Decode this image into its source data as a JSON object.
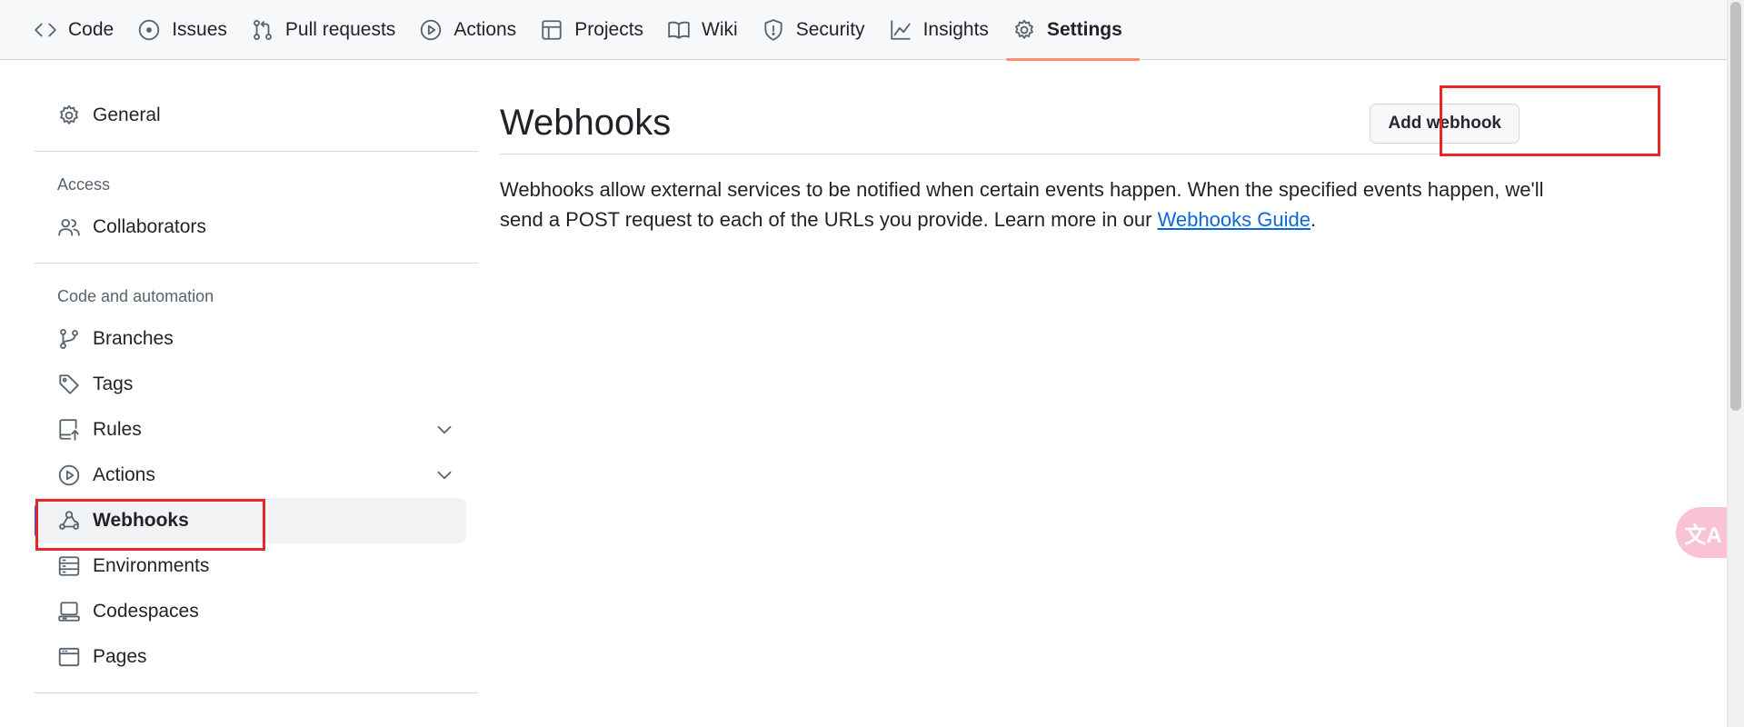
{
  "repo_nav": {
    "tabs": [
      {
        "label": "Code",
        "icon": "code-icon"
      },
      {
        "label": "Issues",
        "icon": "issue-opened-icon"
      },
      {
        "label": "Pull requests",
        "icon": "git-pull-request-icon"
      },
      {
        "label": "Actions",
        "icon": "play-icon"
      },
      {
        "label": "Projects",
        "icon": "table-icon"
      },
      {
        "label": "Wiki",
        "icon": "book-icon"
      },
      {
        "label": "Security",
        "icon": "shield-icon"
      },
      {
        "label": "Insights",
        "icon": "graph-icon"
      },
      {
        "label": "Settings",
        "icon": "gear-icon"
      }
    ],
    "active_tab": "Settings"
  },
  "sidebar": {
    "general": "General",
    "access_heading": "Access",
    "collaborators": "Collaborators",
    "code_heading": "Code and automation",
    "items": [
      {
        "label": "Branches",
        "icon": "git-branch-icon"
      },
      {
        "label": "Tags",
        "icon": "tag-icon"
      },
      {
        "label": "Rules",
        "icon": "repo-push-icon",
        "expandable": true
      },
      {
        "label": "Actions",
        "icon": "play-icon",
        "expandable": true
      },
      {
        "label": "Webhooks",
        "icon": "webhook-icon",
        "active": true
      },
      {
        "label": "Environments",
        "icon": "server-icon"
      },
      {
        "label": "Codespaces",
        "icon": "codespaces-icon"
      },
      {
        "label": "Pages",
        "icon": "browser-icon"
      }
    ]
  },
  "main": {
    "title": "Webhooks",
    "add_button": "Add webhook",
    "description": "Webhooks allow external services to be notified when certain events happen. When the specified events happen, we'll send a POST request to each of the URLs you provide. Learn more in our ",
    "link_text": "Webhooks Guide",
    "description_end": "."
  },
  "translate_widget": "文A",
  "colors": {
    "accent": "#0969da",
    "active_tab_underline": "#fd8c73",
    "highlight": "#e8262a"
  }
}
